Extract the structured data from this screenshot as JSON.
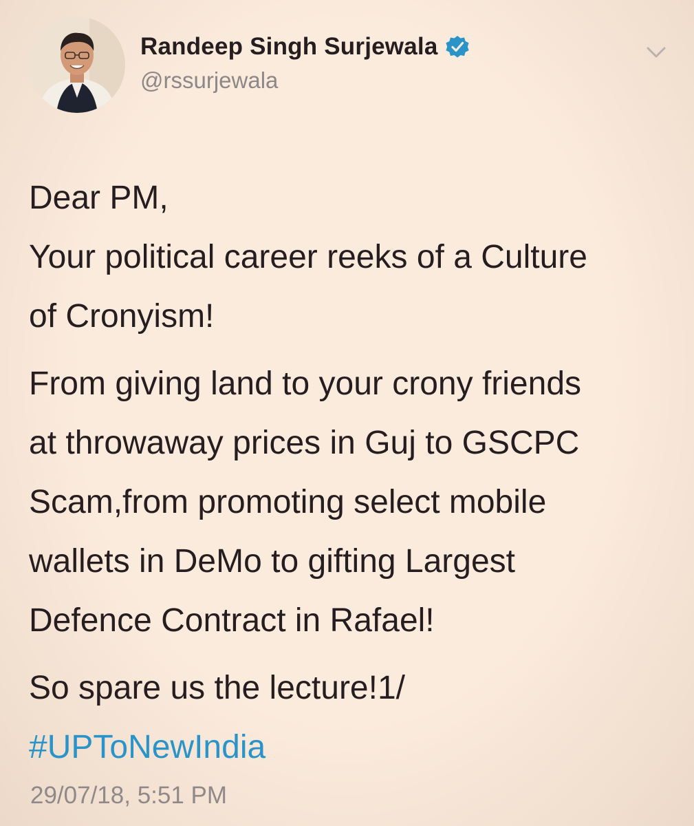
{
  "tweet": {
    "author": {
      "display_name": "Randeep Singh Surjewala",
      "handle": "@rssurjewala",
      "verified": true
    },
    "text_lines": [
      "Dear PM,",
      "Your political career reeks of a Culture",
      "of Cronyism!",
      "From giving land to your crony friends",
      "at throwaway prices in Guj to GSCPC",
      "Scam,from promoting select mobile",
      "wallets in DeMo to gifting Largest",
      "Defence Contract in Rafael!",
      "So spare us the lecture!1/"
    ],
    "hashtag": "#UPToNewIndia",
    "timestamp": "29/07/18, 5:51 PM"
  },
  "icons": {
    "verified": "verified-badge-icon",
    "menu": "chevron-down-icon"
  },
  "colors": {
    "background": "#fbebdc",
    "text": "#251d1f",
    "muted": "#8d8788",
    "link": "#2a94c8",
    "verified": "#2a94c8"
  }
}
